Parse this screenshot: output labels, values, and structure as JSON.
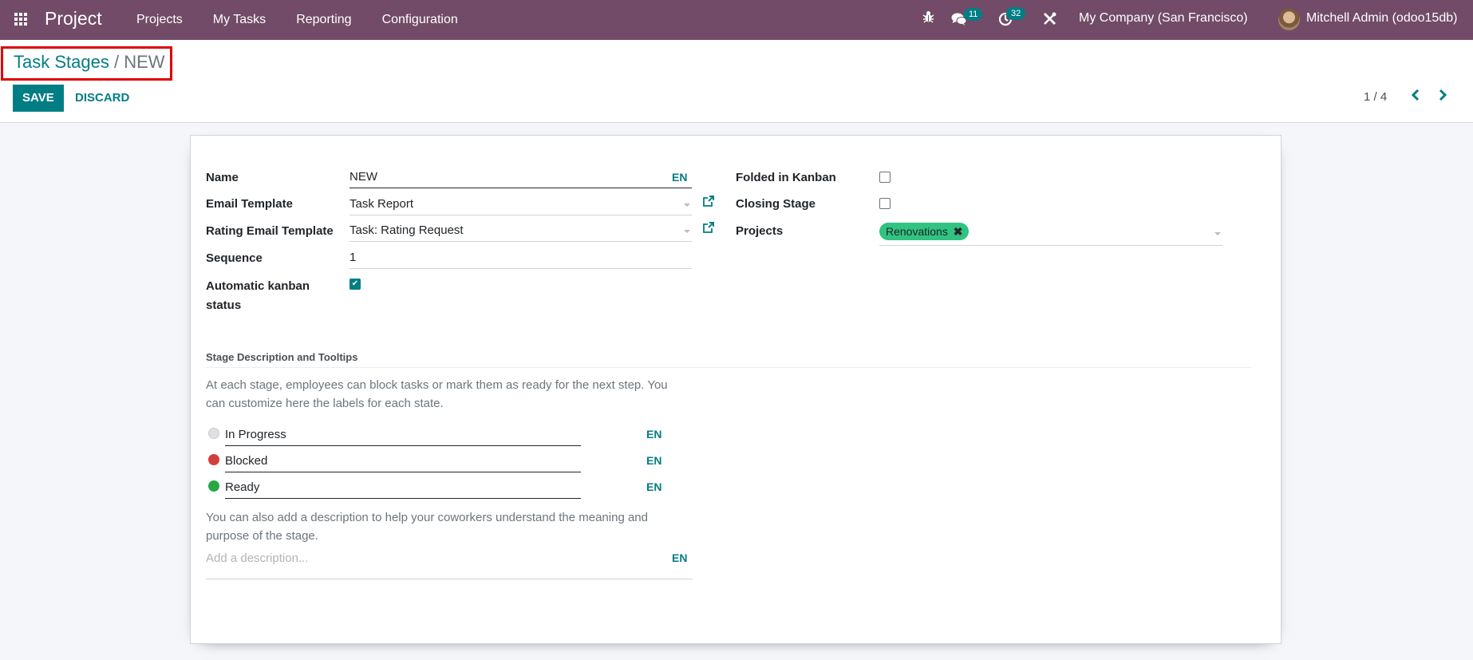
{
  "navbar": {
    "app_title": "Project",
    "menu": [
      "Projects",
      "My Tasks",
      "Reporting",
      "Configuration"
    ],
    "icons": {
      "apps": "apps-grid-icon",
      "debug": "bug-icon",
      "messages": "chat-icon",
      "activities": "clock-icon",
      "tools": "tools-icon"
    },
    "messages_count": "11",
    "activities_count": "32",
    "company": "My Company (San Francisco)",
    "user": "Mitchell Admin (odoo15db)"
  },
  "breadcrumb": {
    "parent": "Task Stages",
    "separator": "/",
    "current": "NEW"
  },
  "toolbar": {
    "save_label": "SAVE",
    "discard_label": "DISCARD"
  },
  "pager": {
    "value": "1 / 4",
    "prev": "‹",
    "next": "›"
  },
  "form": {
    "name": {
      "label": "Name",
      "value": "NEW",
      "lang": "EN"
    },
    "email_template": {
      "label": "Email Template",
      "value": "Task Report"
    },
    "rating_template": {
      "label": "Rating Email Template",
      "value": "Task: Rating Request"
    },
    "sequence": {
      "label": "Sequence",
      "value": "1"
    },
    "auto_kanban": {
      "label_line1": "Automatic kanban",
      "label_line2": "status",
      "checked": true
    },
    "folded": {
      "label": "Folded in Kanban",
      "checked": false
    },
    "closing": {
      "label": "Closing Stage",
      "checked": false
    },
    "projects": {
      "label": "Projects",
      "tags": [
        "Renovations"
      ]
    }
  },
  "stage_section": {
    "title": "Stage Description and Tooltips",
    "help_line1": "At each stage, employees can block tasks or mark them as ready for the next step. You",
    "help_line2": "can customize here the labels for each state.",
    "states": [
      {
        "label": "In Progress",
        "color": "#dee2e6",
        "lang": "EN"
      },
      {
        "label": "Blocked",
        "color": "#d23f3a",
        "lang": "EN"
      },
      {
        "label": "Ready",
        "color": "#28a745",
        "lang": "EN"
      }
    ],
    "desc_help_line1": "You can also add a description to help your coworkers understand the meaning and",
    "desc_help_line2": "purpose of the stage.",
    "description_placeholder": "Add a description...",
    "description_lang": "EN"
  }
}
